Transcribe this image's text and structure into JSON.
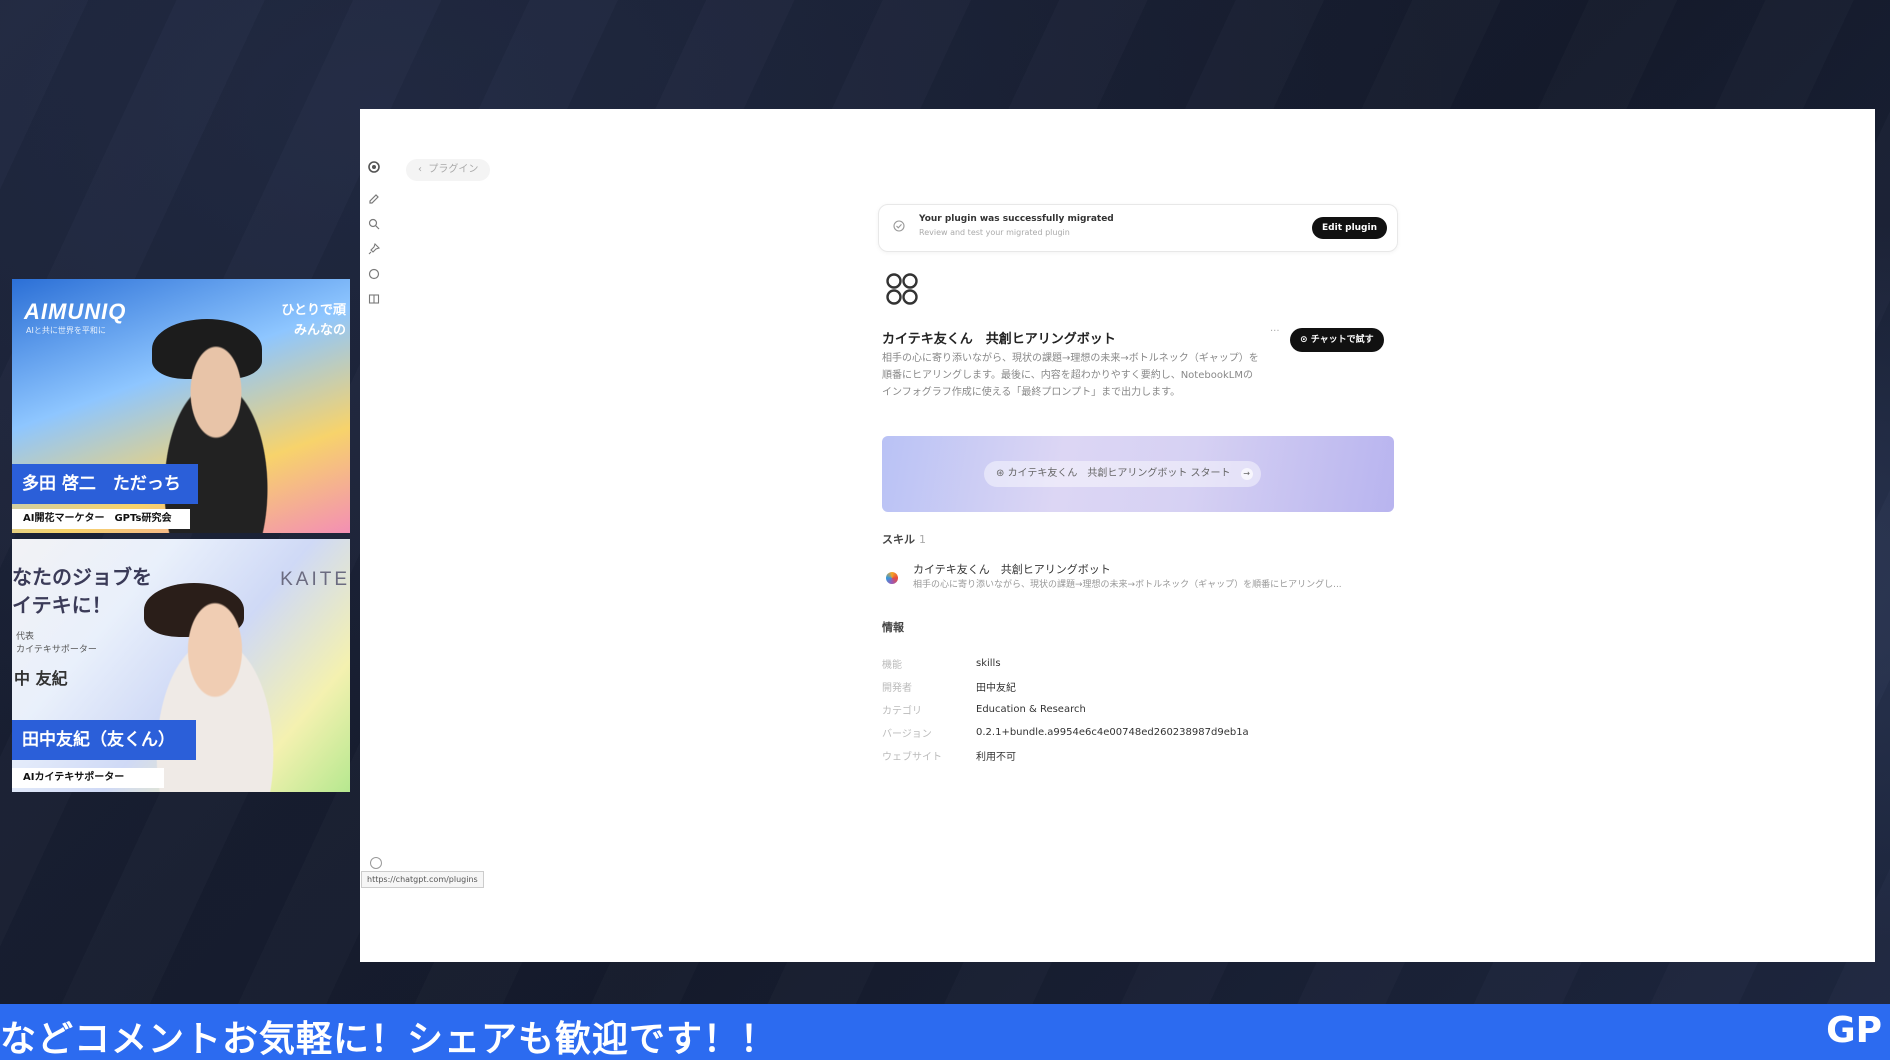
{
  "speakers": [
    {
      "brand": "AIMUNIQ",
      "brand_sub": "AIと共に世界を平和に",
      "tagline_1": "ひとりで頑",
      "tagline_2": "みんなの",
      "name": "多田 啓二　ただっち",
      "role": "AI開花マーケター　GPTs研究会"
    },
    {
      "bg_line_1": "なたのジョブを",
      "bg_line_2": "イテキに！",
      "bg_small": "代表\nカイテキサポーター",
      "bg_name": "中 友紀",
      "bg_logo": "KAITE",
      "name": "田中友紀（友くん）",
      "role": "AIカイテキサポーター"
    }
  ],
  "screen": {
    "back_label": "プラグイン",
    "banner": {
      "title": "Your plugin was successfully migrated",
      "subtitle": "Review and test your migrated plugin",
      "edit_label": "Edit plugin"
    },
    "plugin": {
      "title": "カイテキ友くん　共創ヒアリングボット",
      "chat_label": "チャットで試す",
      "more": "···",
      "description": "相手の心に寄り添いながら、現状の課題→理想の未来→ボトルネック（ギャップ）を順番にヒアリングします。最後に、内容を超わかりやすく要約し、NotebookLMのインフォグラフ作成に使える「最終プロンプト」まで出力します。",
      "start_label": "カイテキ友くん　共創ヒアリングボット スタート"
    },
    "skills": {
      "heading": "スキル",
      "count": "1",
      "items": [
        {
          "name": "カイテキ友くん　共創ヒアリングボット",
          "desc": "相手の心に寄り添いながら、現状の課題→理想の未来→ボトルネック（ギャップ）を順番にヒアリングし..."
        }
      ]
    },
    "info": {
      "heading": "情報",
      "rows": [
        {
          "label": "機能",
          "value": "skills"
        },
        {
          "label": "開発者",
          "value": "田中友紀"
        },
        {
          "label": "カテゴリ",
          "value": "Education & Research"
        },
        {
          "label": "バージョン",
          "value": "0.2.1+bundle.a9954e6c4e00748ed260238987d9eb1a"
        },
        {
          "label": "ウェブサイト",
          "value": "利用不可"
        }
      ]
    },
    "status_url": "https://chatgpt.com/plugins"
  },
  "ticker": {
    "message": "などコメントお気軽に！シェアも歓迎です！！",
    "tail": "GP"
  },
  "colors": {
    "ticker_bg": "#2c6bf0",
    "nameplate_bg": "#2b5fd9",
    "button_bg": "#111111"
  }
}
